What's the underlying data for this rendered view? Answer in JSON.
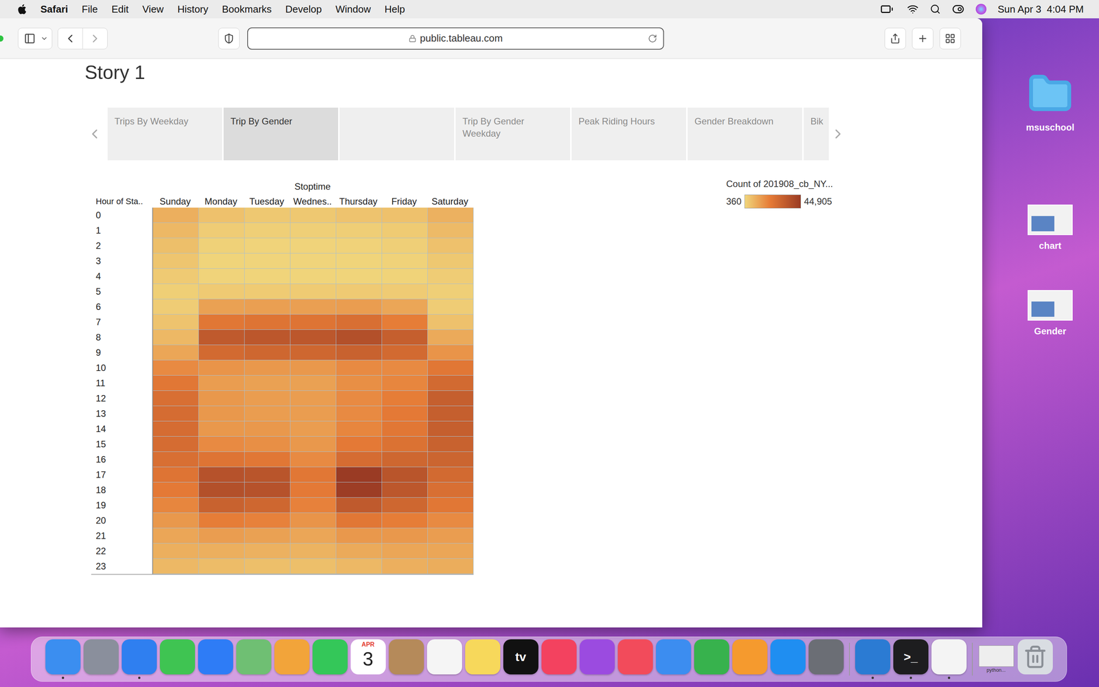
{
  "menu_bar": {
    "app": "Safari",
    "items": [
      "File",
      "Edit",
      "View",
      "History",
      "Bookmarks",
      "Develop",
      "Window",
      "Help"
    ],
    "clock": "Sun Apr 3  4:04 PM"
  },
  "browser": {
    "url": "public.tableau.com"
  },
  "story": {
    "title": "Story 1",
    "tabs": [
      {
        "label": "Trips By Weekday",
        "selected": false
      },
      {
        "label": "Trip By Gender",
        "selected": true
      },
      {
        "label": "",
        "selected": false
      },
      {
        "label": "Trip By Gender Weekday",
        "selected": false
      },
      {
        "label": "Peak Riding Hours",
        "selected": false
      },
      {
        "label": "Gender Breakdown",
        "selected": false
      },
      {
        "label": "Bik",
        "selected": false
      }
    ]
  },
  "heatmap": {
    "column_title": "Stoptime",
    "row_header": "Hour of Sta..",
    "columns": [
      "Sunday",
      "Monday",
      "Tuesday",
      "Wednes..",
      "Thursday",
      "Friday",
      "Saturday"
    ],
    "rows": [
      {
        "hour": "0",
        "values": [
          9000,
          5000,
          3500,
          3500,
          4500,
          5000,
          8500
        ]
      },
      {
        "hour": "1",
        "values": [
          7000,
          2500,
          1800,
          1800,
          2200,
          2800,
          6500
        ]
      },
      {
        "hour": "2",
        "values": [
          5500,
          1500,
          1000,
          1000,
          1300,
          1800,
          5000
        ]
      },
      {
        "hour": "3",
        "values": [
          4000,
          900,
          700,
          700,
          800,
          1200,
          3500
        ]
      },
      {
        "hour": "4",
        "values": [
          3000,
          1000,
          800,
          800,
          900,
          1100,
          2500
        ]
      },
      {
        "hour": "5",
        "values": [
          2000,
          3000,
          2800,
          2800,
          3000,
          2700,
          1800
        ]
      },
      {
        "hour": "6",
        "values": [
          2500,
          12000,
          12500,
          12500,
          13000,
          11000,
          2500
        ]
      },
      {
        "hour": "7",
        "values": [
          4500,
          22000,
          23000,
          23000,
          25000,
          20000,
          5000
        ]
      },
      {
        "hour": "8",
        "values": [
          7000,
          33000,
          34000,
          34000,
          37000,
          31000,
          10000
        ]
      },
      {
        "hour": "9",
        "values": [
          11000,
          27000,
          28000,
          28000,
          30000,
          27000,
          15000
        ]
      },
      {
        "hour": "10",
        "values": [
          17000,
          15000,
          14000,
          14000,
          17000,
          17000,
          22000
        ]
      },
      {
        "hour": "11",
        "values": [
          22000,
          13000,
          12000,
          12000,
          16000,
          18000,
          27000
        ]
      },
      {
        "hour": "12",
        "values": [
          25000,
          14000,
          13000,
          13000,
          17000,
          20000,
          31000
        ]
      },
      {
        "hour": "13",
        "values": [
          26000,
          14000,
          13000,
          13000,
          17000,
          21000,
          31000
        ]
      },
      {
        "hour": "14",
        "values": [
          26000,
          14000,
          14000,
          13000,
          18000,
          22000,
          31000
        ]
      },
      {
        "hour": "15",
        "values": [
          26000,
          17000,
          16000,
          14000,
          21000,
          24000,
          30000
        ]
      },
      {
        "hour": "16",
        "values": [
          25000,
          23000,
          22000,
          17000,
          26000,
          28000,
          29000
        ]
      },
      {
        "hour": "17",
        "values": [
          23000,
          36000,
          35000,
          22000,
          44905,
          35000,
          27000
        ]
      },
      {
        "hour": "18",
        "values": [
          21000,
          37000,
          36000,
          21000,
          44000,
          34000,
          25000
        ]
      },
      {
        "hour": "19",
        "values": [
          18000,
          30000,
          28000,
          19000,
          33000,
          28000,
          22000
        ]
      },
      {
        "hour": "20",
        "values": [
          14000,
          20000,
          19000,
          15000,
          22000,
          20000,
          17000
        ]
      },
      {
        "hour": "21",
        "values": [
          11000,
          13000,
          12000,
          11000,
          14000,
          14000,
          13000
        ]
      },
      {
        "hour": "22",
        "values": [
          9000,
          9000,
          8500,
          8000,
          10000,
          11000,
          11000
        ]
      },
      {
        "hour": "23",
        "values": [
          7000,
          6000,
          5500,
          5500,
          7000,
          9000,
          9500
        ]
      }
    ]
  },
  "legend": {
    "title": "Count of 201908_cb_NY...",
    "min": "360",
    "max": "44,905",
    "min_value": 360,
    "max_value": 44905
  },
  "desktop_icons": [
    {
      "label": "msuschool",
      "kind": "folder"
    },
    {
      "label": "chart",
      "kind": "thumbnail"
    },
    {
      "label": "Gender",
      "kind": "thumbnail"
    }
  ],
  "dock": [
    {
      "kind": "app",
      "color": "#3b8ef0",
      "glyph": "",
      "running": true
    },
    {
      "kind": "app",
      "color": "#8a8f9c",
      "glyph": "",
      "running": false
    },
    {
      "kind": "app",
      "color": "#2f7ff0",
      "glyph": "",
      "running": true
    },
    {
      "kind": "app",
      "color": "#3fc452",
      "glyph": "",
      "running": false
    },
    {
      "kind": "app",
      "color": "#2e7cf6",
      "glyph": "",
      "running": false
    },
    {
      "kind": "app",
      "color": "#6fbf73",
      "glyph": "",
      "running": false
    },
    {
      "kind": "app",
      "color": "#f2a43a",
      "glyph": "",
      "running": false
    },
    {
      "kind": "app",
      "color": "#34c759",
      "glyph": "",
      "running": false
    },
    {
      "kind": "calendar",
      "color": "#ffffff",
      "glyph": "APR",
      "day": "3",
      "running": false
    },
    {
      "kind": "app",
      "color": "#b58a5a",
      "glyph": "",
      "running": false
    },
    {
      "kind": "app",
      "color": "#f5f5f5",
      "glyph": "",
      "running": false
    },
    {
      "kind": "app",
      "color": "#f7d85b",
      "glyph": "",
      "running": false
    },
    {
      "kind": "app",
      "color": "#111111",
      "glyph": "tv",
      "running": false
    },
    {
      "kind": "app",
      "color": "#f3425f",
      "glyph": "",
      "running": false
    },
    {
      "kind": "app",
      "color": "#9b4be0",
      "glyph": "",
      "running": false
    },
    {
      "kind": "app",
      "color": "#f24b5b",
      "glyph": "",
      "running": false
    },
    {
      "kind": "app",
      "color": "#3c8df0",
      "glyph": "",
      "running": false
    },
    {
      "kind": "app",
      "color": "#37b24d",
      "glyph": "",
      "running": false
    },
    {
      "kind": "app",
      "color": "#f59a2e",
      "glyph": "",
      "running": false
    },
    {
      "kind": "app",
      "color": "#1f8ef1",
      "glyph": "",
      "running": false
    },
    {
      "kind": "app",
      "color": "#6b6e75",
      "glyph": "",
      "running": false
    },
    {
      "kind": "divider",
      "color": "#9a9a9a",
      "glyph": "",
      "running": false
    },
    {
      "kind": "app",
      "color": "#2b7bd3",
      "glyph": "",
      "running": true
    },
    {
      "kind": "app",
      "color": "#1d1d1f",
      "glyph": ">_",
      "running": true
    },
    {
      "kind": "app",
      "color": "#f4f4f4",
      "glyph": "",
      "running": true
    },
    {
      "kind": "divider",
      "color": "#9a9a9a",
      "glyph": "",
      "running": false
    },
    {
      "kind": "thumbnail",
      "color": "#eeeeee",
      "glyph": "python...",
      "running": false
    },
    {
      "kind": "trash",
      "color": "#d9dde2",
      "glyph": "",
      "running": false
    }
  ]
}
